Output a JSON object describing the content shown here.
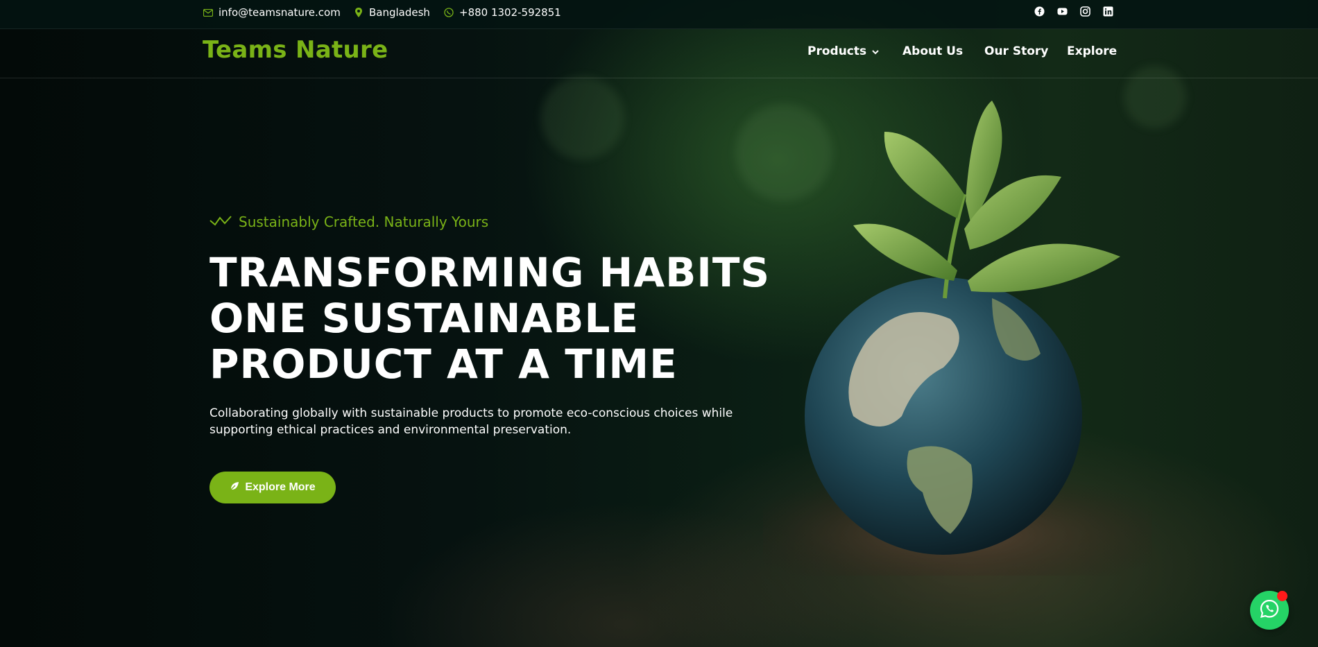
{
  "topbar": {
    "email": "info@teamsnature.com",
    "location": "Bangladesh",
    "phone": "+880 1302-592851",
    "social_icons": [
      "facebook-icon",
      "youtube-icon",
      "instagram-icon",
      "linkedin-icon"
    ]
  },
  "header": {
    "logo": "Teams Nature",
    "nav": [
      {
        "label": "Products",
        "has_dropdown": true
      },
      {
        "label": "About Us"
      },
      {
        "label": "Our Story"
      },
      {
        "label": "Explore"
      }
    ]
  },
  "hero": {
    "tagline": "Sustainably Crafted. Naturally Yours",
    "headline_lines": [
      "TRANSFORMING HABITS",
      "ONE SUSTAINABLE",
      "PRODUCT AT A TIME"
    ],
    "description": "Collaborating globally with sustainable products to promote eco-conscious choices while supporting ethical practices and environmental preservation.",
    "cta_label": "Explore More"
  },
  "colors": {
    "accent": "#7ab317",
    "topbar_bg": "#031412",
    "whatsapp": "#25d366",
    "notification": "#ff1a1a"
  }
}
